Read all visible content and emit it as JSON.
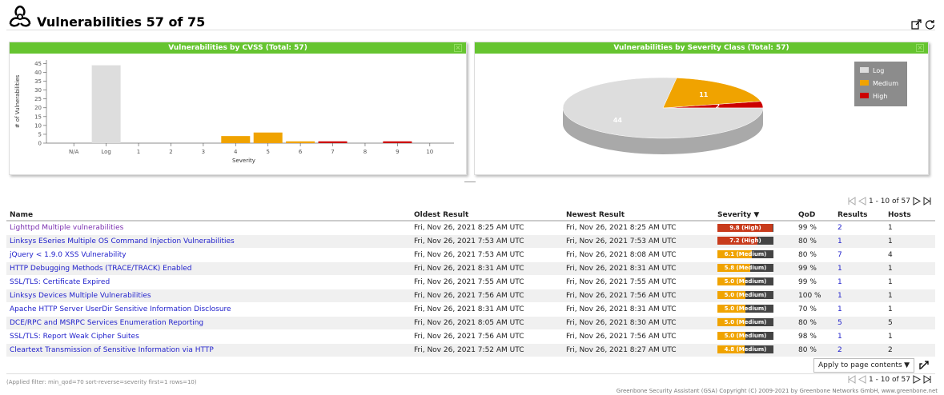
{
  "header": {
    "title": "Vulnerabilities 57 of 75",
    "icon": "biohazard-icon"
  },
  "charts": {
    "cvss_title": "Vulnerabilities by CVSS (Total: 57)",
    "severity_title": "Vulnerabilities by Severity Class (Total: 57)"
  },
  "chart_data": [
    {
      "type": "bar",
      "title": "Vulnerabilities by CVSS (Total: 57)",
      "xlabel": "Severity",
      "ylabel": "# of Vulnerabilities",
      "categories": [
        "N/A",
        "Log",
        "1",
        "2",
        "3",
        "4",
        "5",
        "6",
        "7",
        "8",
        "9",
        "10"
      ],
      "values": [
        0,
        44,
        0,
        0,
        0,
        4,
        6,
        1,
        1,
        0,
        1,
        0
      ],
      "colors": [
        "#ddd",
        "#ddd",
        "#ddd",
        "#ddd",
        "#ddd",
        "#f0a300",
        "#f0a300",
        "#f0a300",
        "#c00",
        "#c00",
        "#c00",
        "#c00"
      ],
      "yticks": [
        0,
        5,
        10,
        15,
        20,
        25,
        30,
        35,
        40,
        45
      ],
      "ylim": [
        0,
        47
      ]
    },
    {
      "type": "pie",
      "title": "Vulnerabilities by Severity Class (Total: 57)",
      "labels": [
        "Log",
        "Medium",
        "High"
      ],
      "values": [
        44,
        11,
        2
      ],
      "colors": [
        "#dddddd",
        "#f0a300",
        "#cc0000"
      ],
      "legend_position": "top-right"
    }
  ],
  "pager": {
    "text": "1 - 10 of 57"
  },
  "table": {
    "headers": [
      "Name",
      "Oldest Result",
      "Newest Result",
      "Severity ▼",
      "QoD",
      "Results",
      "Hosts"
    ],
    "rows": [
      {
        "name": "Lighttpd Multiple vulnerabilities",
        "oldest": "Fri, Nov 26, 2021 8:25 AM UTC",
        "newest": "Fri, Nov 26, 2021 8:25 AM UTC",
        "sev_label": "9.8 (High)",
        "sev_fill": 0.98,
        "sev_color": "#c83b1c",
        "qod": "99 %",
        "results": "2",
        "hosts": "1",
        "visited": true
      },
      {
        "name": "Linksys ESeries Multiple OS Command Injection Vulnerabilities",
        "oldest": "Fri, Nov 26, 2021 7:53 AM UTC",
        "newest": "Fri, Nov 26, 2021 7:53 AM UTC",
        "sev_label": "7.2 (High)",
        "sev_fill": 0.72,
        "sev_color": "#c83b1c",
        "qod": "80 %",
        "results": "1",
        "hosts": "1",
        "visited": false
      },
      {
        "name": "jQuery < 1.9.0 XSS Vulnerability",
        "oldest": "Fri, Nov 26, 2021 7:53 AM UTC",
        "newest": "Fri, Nov 26, 2021 8:08 AM UTC",
        "sev_label": "6.1 (Medium)",
        "sev_fill": 0.61,
        "sev_color": "#f0a300",
        "qod": "80 %",
        "results": "7",
        "hosts": "4",
        "visited": false
      },
      {
        "name": "HTTP Debugging Methods (TRACE/TRACK) Enabled",
        "oldest": "Fri, Nov 26, 2021 8:31 AM UTC",
        "newest": "Fri, Nov 26, 2021 8:31 AM UTC",
        "sev_label": "5.8 (Medium)",
        "sev_fill": 0.58,
        "sev_color": "#f0a300",
        "qod": "99 %",
        "results": "1",
        "hosts": "1",
        "visited": false
      },
      {
        "name": "SSL/TLS: Certificate Expired",
        "oldest": "Fri, Nov 26, 2021 7:55 AM UTC",
        "newest": "Fri, Nov 26, 2021 7:55 AM UTC",
        "sev_label": "5.0 (Medium)",
        "sev_fill": 0.5,
        "sev_color": "#f0a300",
        "qod": "99 %",
        "results": "1",
        "hosts": "1",
        "visited": false
      },
      {
        "name": "Linksys Devices Multiple Vulnerabilities",
        "oldest": "Fri, Nov 26, 2021 7:56 AM UTC",
        "newest": "Fri, Nov 26, 2021 7:56 AM UTC",
        "sev_label": "5.0 (Medium)",
        "sev_fill": 0.5,
        "sev_color": "#f0a300",
        "qod": "100 %",
        "results": "1",
        "hosts": "1",
        "visited": false
      },
      {
        "name": "Apache HTTP Server UserDir Sensitive Information Disclosure",
        "oldest": "Fri, Nov 26, 2021 8:31 AM UTC",
        "newest": "Fri, Nov 26, 2021 8:31 AM UTC",
        "sev_label": "5.0 (Medium)",
        "sev_fill": 0.5,
        "sev_color": "#f0a300",
        "qod": "70 %",
        "results": "1",
        "hosts": "1",
        "visited": false
      },
      {
        "name": "DCE/RPC and MSRPC Services Enumeration Reporting",
        "oldest": "Fri, Nov 26, 2021 8:05 AM UTC",
        "newest": "Fri, Nov 26, 2021 8:30 AM UTC",
        "sev_label": "5.0 (Medium)",
        "sev_fill": 0.5,
        "sev_color": "#f0a300",
        "qod": "80 %",
        "results": "5",
        "hosts": "5",
        "visited": false
      },
      {
        "name": "SSL/TLS: Report Weak Cipher Suites",
        "oldest": "Fri, Nov 26, 2021 7:56 AM UTC",
        "newest": "Fri, Nov 26, 2021 7:56 AM UTC",
        "sev_label": "5.0 (Medium)",
        "sev_fill": 0.5,
        "sev_color": "#f0a300",
        "qod": "98 %",
        "results": "1",
        "hosts": "1",
        "visited": false
      },
      {
        "name": "Cleartext Transmission of Sensitive Information via HTTP",
        "oldest": "Fri, Nov 26, 2021 7:52 AM UTC",
        "newest": "Fri, Nov 26, 2021 8:27 AM UTC",
        "sev_label": "4.8 (Medium)",
        "sev_fill": 0.48,
        "sev_color": "#f0a300",
        "qod": "80 %",
        "results": "2",
        "hosts": "2",
        "visited": false
      }
    ]
  },
  "apply_select": {
    "value": "Apply to page contents"
  },
  "filter_text": "(Applied filter: min_qod=70 sort-reverse=severity first=1 rows=10)",
  "footer": "Greenbone Security Assistant (GSA) Copyright (C) 2009-2021 by Greenbone Networks GmbH,  www.greenbone.net"
}
